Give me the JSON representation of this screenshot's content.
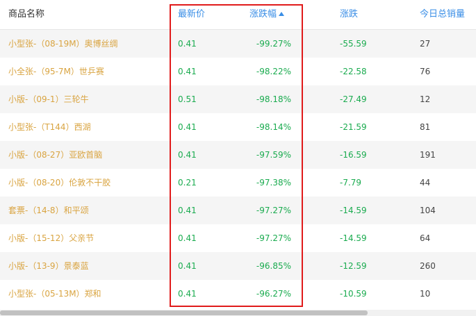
{
  "header": {
    "name": "商品名称",
    "price": "最新价",
    "pct_change": "涨跌幅",
    "change": "涨跌",
    "volume": "今日总销量"
  },
  "rows": [
    {
      "name": "小型张-（08-19M）奥博丝绸",
      "price": "0.41",
      "pct": "-99.27%",
      "change": "-55.59",
      "volume": "27"
    },
    {
      "name": "小全张-（95-7M）世乒赛",
      "price": "0.41",
      "pct": "-98.22%",
      "change": "-22.58",
      "volume": "76"
    },
    {
      "name": "小版-（09-1）三轮牛",
      "price": "0.51",
      "pct": "-98.18%",
      "change": "-27.49",
      "volume": "12"
    },
    {
      "name": "小型张-（T144）西湖",
      "price": "0.41",
      "pct": "-98.14%",
      "change": "-21.59",
      "volume": "81"
    },
    {
      "name": "小版-（08-27）亚欧首脑",
      "price": "0.41",
      "pct": "-97.59%",
      "change": "-16.59",
      "volume": "191"
    },
    {
      "name": "小版-（08-20）伦敦不干胶",
      "price": "0.21",
      "pct": "-97.38%",
      "change": "-7.79",
      "volume": "44"
    },
    {
      "name": "套票-（14-8）和平颂",
      "price": "0.41",
      "pct": "-97.27%",
      "change": "-14.59",
      "volume": "104"
    },
    {
      "name": "小版-（15-12）父亲节",
      "price": "0.41",
      "pct": "-97.27%",
      "change": "-14.59",
      "volume": "64"
    },
    {
      "name": "小版-（13-9）景泰蓝",
      "price": "0.41",
      "pct": "-96.85%",
      "change": "-12.59",
      "volume": "260"
    },
    {
      "name": "小型张-（05-13M）郑和",
      "price": "0.41",
      "pct": "-96.27%",
      "change": "-10.59",
      "volume": "10"
    }
  ],
  "colors": {
    "header_link": "#3a8ee6",
    "product_name": "#d9a441",
    "negative": "#1aab4f",
    "highlight": "#e01a1a"
  }
}
